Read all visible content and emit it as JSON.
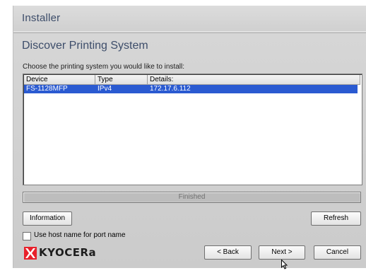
{
  "window": {
    "title": "Installer"
  },
  "page": {
    "title": "Discover Printing System",
    "instruction": "Choose the printing system you would like to install:"
  },
  "device_list": {
    "columns": [
      "Device",
      "Type",
      "Details:"
    ],
    "rows": [
      {
        "device": "FS-1128MFP",
        "type": "IPv4",
        "details": "172.17.6.112",
        "selected": true
      }
    ]
  },
  "progress": {
    "text": "Finished",
    "value": 1.0
  },
  "buttons": {
    "information": "Information",
    "refresh": "Refresh",
    "back": "< Back",
    "next": "Next >",
    "cancel": "Cancel"
  },
  "options": {
    "use_host_name": {
      "label": "Use host name for port name",
      "checked": false
    }
  },
  "brand": {
    "name": "KYOCERa",
    "color": "#e8202a"
  },
  "colors": {
    "selection": "#2a5ad1",
    "title_text": "#3d4d6a"
  }
}
